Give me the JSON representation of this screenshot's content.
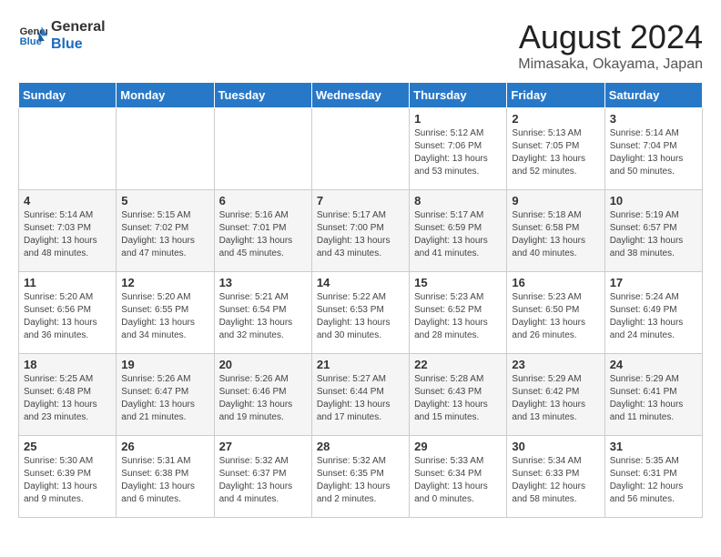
{
  "logo": {
    "line1": "General",
    "line2": "Blue"
  },
  "title": "August 2024",
  "location": "Mimasaka, Okayama, Japan",
  "weekdays": [
    "Sunday",
    "Monday",
    "Tuesday",
    "Wednesday",
    "Thursday",
    "Friday",
    "Saturday"
  ],
  "weeks": [
    [
      {
        "day": "",
        "content": ""
      },
      {
        "day": "",
        "content": ""
      },
      {
        "day": "",
        "content": ""
      },
      {
        "day": "",
        "content": ""
      },
      {
        "day": "1",
        "content": "Sunrise: 5:12 AM\nSunset: 7:06 PM\nDaylight: 13 hours\nand 53 minutes."
      },
      {
        "day": "2",
        "content": "Sunrise: 5:13 AM\nSunset: 7:05 PM\nDaylight: 13 hours\nand 52 minutes."
      },
      {
        "day": "3",
        "content": "Sunrise: 5:14 AM\nSunset: 7:04 PM\nDaylight: 13 hours\nand 50 minutes."
      }
    ],
    [
      {
        "day": "4",
        "content": "Sunrise: 5:14 AM\nSunset: 7:03 PM\nDaylight: 13 hours\nand 48 minutes."
      },
      {
        "day": "5",
        "content": "Sunrise: 5:15 AM\nSunset: 7:02 PM\nDaylight: 13 hours\nand 47 minutes."
      },
      {
        "day": "6",
        "content": "Sunrise: 5:16 AM\nSunset: 7:01 PM\nDaylight: 13 hours\nand 45 minutes."
      },
      {
        "day": "7",
        "content": "Sunrise: 5:17 AM\nSunset: 7:00 PM\nDaylight: 13 hours\nand 43 minutes."
      },
      {
        "day": "8",
        "content": "Sunrise: 5:17 AM\nSunset: 6:59 PM\nDaylight: 13 hours\nand 41 minutes."
      },
      {
        "day": "9",
        "content": "Sunrise: 5:18 AM\nSunset: 6:58 PM\nDaylight: 13 hours\nand 40 minutes."
      },
      {
        "day": "10",
        "content": "Sunrise: 5:19 AM\nSunset: 6:57 PM\nDaylight: 13 hours\nand 38 minutes."
      }
    ],
    [
      {
        "day": "11",
        "content": "Sunrise: 5:20 AM\nSunset: 6:56 PM\nDaylight: 13 hours\nand 36 minutes."
      },
      {
        "day": "12",
        "content": "Sunrise: 5:20 AM\nSunset: 6:55 PM\nDaylight: 13 hours\nand 34 minutes."
      },
      {
        "day": "13",
        "content": "Sunrise: 5:21 AM\nSunset: 6:54 PM\nDaylight: 13 hours\nand 32 minutes."
      },
      {
        "day": "14",
        "content": "Sunrise: 5:22 AM\nSunset: 6:53 PM\nDaylight: 13 hours\nand 30 minutes."
      },
      {
        "day": "15",
        "content": "Sunrise: 5:23 AM\nSunset: 6:52 PM\nDaylight: 13 hours\nand 28 minutes."
      },
      {
        "day": "16",
        "content": "Sunrise: 5:23 AM\nSunset: 6:50 PM\nDaylight: 13 hours\nand 26 minutes."
      },
      {
        "day": "17",
        "content": "Sunrise: 5:24 AM\nSunset: 6:49 PM\nDaylight: 13 hours\nand 24 minutes."
      }
    ],
    [
      {
        "day": "18",
        "content": "Sunrise: 5:25 AM\nSunset: 6:48 PM\nDaylight: 13 hours\nand 23 minutes."
      },
      {
        "day": "19",
        "content": "Sunrise: 5:26 AM\nSunset: 6:47 PM\nDaylight: 13 hours\nand 21 minutes."
      },
      {
        "day": "20",
        "content": "Sunrise: 5:26 AM\nSunset: 6:46 PM\nDaylight: 13 hours\nand 19 minutes."
      },
      {
        "day": "21",
        "content": "Sunrise: 5:27 AM\nSunset: 6:44 PM\nDaylight: 13 hours\nand 17 minutes."
      },
      {
        "day": "22",
        "content": "Sunrise: 5:28 AM\nSunset: 6:43 PM\nDaylight: 13 hours\nand 15 minutes."
      },
      {
        "day": "23",
        "content": "Sunrise: 5:29 AM\nSunset: 6:42 PM\nDaylight: 13 hours\nand 13 minutes."
      },
      {
        "day": "24",
        "content": "Sunrise: 5:29 AM\nSunset: 6:41 PM\nDaylight: 13 hours\nand 11 minutes."
      }
    ],
    [
      {
        "day": "25",
        "content": "Sunrise: 5:30 AM\nSunset: 6:39 PM\nDaylight: 13 hours\nand 9 minutes."
      },
      {
        "day": "26",
        "content": "Sunrise: 5:31 AM\nSunset: 6:38 PM\nDaylight: 13 hours\nand 6 minutes."
      },
      {
        "day": "27",
        "content": "Sunrise: 5:32 AM\nSunset: 6:37 PM\nDaylight: 13 hours\nand 4 minutes."
      },
      {
        "day": "28",
        "content": "Sunrise: 5:32 AM\nSunset: 6:35 PM\nDaylight: 13 hours\nand 2 minutes."
      },
      {
        "day": "29",
        "content": "Sunrise: 5:33 AM\nSunset: 6:34 PM\nDaylight: 13 hours\nand 0 minutes."
      },
      {
        "day": "30",
        "content": "Sunrise: 5:34 AM\nSunset: 6:33 PM\nDaylight: 12 hours\nand 58 minutes."
      },
      {
        "day": "31",
        "content": "Sunrise: 5:35 AM\nSunset: 6:31 PM\nDaylight: 12 hours\nand 56 minutes."
      }
    ]
  ]
}
